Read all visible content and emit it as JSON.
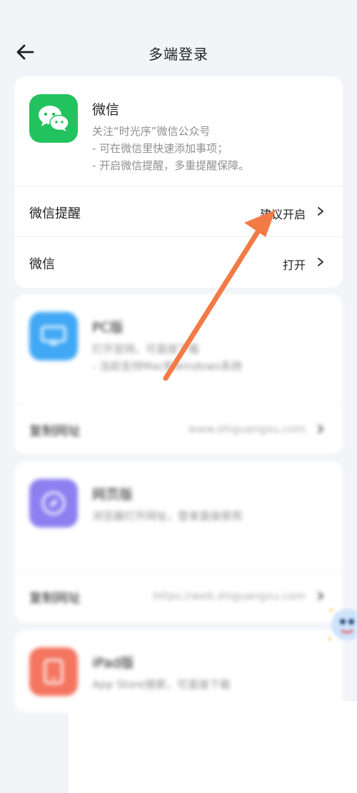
{
  "header": {
    "title": "多端登录",
    "back_icon": "back-arrow-icon"
  },
  "wechat_card": {
    "icon": "wechat-icon",
    "icon_color": "#22c35e",
    "title": "微信",
    "desc_lines": [
      "关注“时光序”微信公众号",
      "- 可在微信里快速添加事项；",
      "- 开启微信提醒，多重提醒保障。"
    ],
    "rows": [
      {
        "label": "微信提醒",
        "value": "建议开启"
      },
      {
        "label": "微信",
        "value": "打开"
      }
    ]
  },
  "pc_card": {
    "icon": "monitor-icon",
    "icon_color": "#41a8f5",
    "title": "PC版",
    "desc_lines": [
      "打开官网，可直接下载",
      "- 当前支持Mac和windows系统"
    ],
    "row_label": "复制网址",
    "row_value": "www.shiguangxu.com"
  },
  "web_card": {
    "icon": "compass-icon",
    "icon_color": "#8d7ff0",
    "title": "网页版",
    "desc_lines": [
      "浏览器打开网址，登录直接使用"
    ],
    "row_label": "复制网址",
    "row_value": "https://web.shiguangxu.com"
  },
  "ipad_card": {
    "icon": "tablet-icon",
    "icon_color": "#f47560",
    "title": "iPad版",
    "desc_lines": [
      "App Store搜索，可直接下载"
    ]
  },
  "annotation": {
    "arrow_color": "#f27a45"
  }
}
